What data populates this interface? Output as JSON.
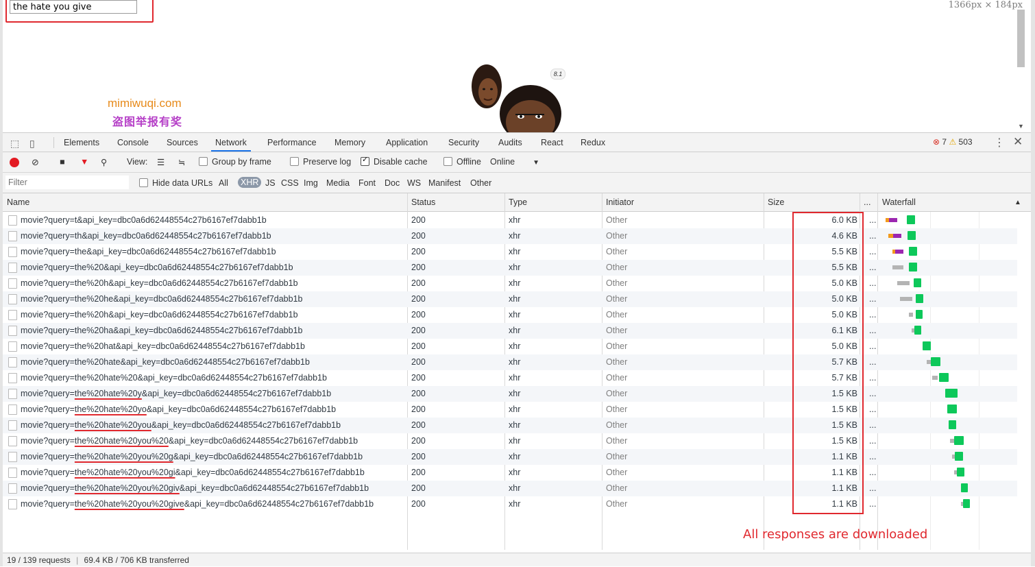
{
  "page": {
    "search_value": "the hate you give",
    "dimensions": "1366px  ×  184px",
    "watermark_line1": "mimiwuqi.com",
    "watermark_line2": "盗图举报有奖",
    "rating": "8.1"
  },
  "devtools": {
    "tabs": [
      "Elements",
      "Console",
      "Sources",
      "Network",
      "Performance",
      "Memory",
      "Application",
      "Security",
      "Audits",
      "React",
      "Redux"
    ],
    "active_tab": "Network",
    "error_count": "7",
    "warning_count": "503",
    "toolbar": {
      "view_label": "View:",
      "group_by_frame": "Group by frame",
      "preserve_log": "Preserve log",
      "disable_cache": "Disable cache",
      "offline": "Offline",
      "throttle": "Online"
    },
    "filter": {
      "placeholder": "Filter",
      "hide_data_urls": "Hide data URLs",
      "types": [
        "All",
        "XHR",
        "JS",
        "CSS",
        "Img",
        "Media",
        "Font",
        "Doc",
        "WS",
        "Manifest",
        "Other"
      ],
      "active_type": "XHR"
    },
    "columns": {
      "name": "Name",
      "status": "Status",
      "type": "Type",
      "initiator": "Initiator",
      "size": "Size",
      "more": "...",
      "waterfall": "Waterfall"
    },
    "rows": [
      {
        "prefix": "movie?query=",
        "query": "t",
        "suffix": "&api_key=dbc0a6d62448554c27b6167ef7dabb1b",
        "status": "200",
        "type": "xhr",
        "initiator": "Other",
        "size": "6.0 KB"
      },
      {
        "prefix": "movie?query=",
        "query": "th",
        "suffix": "&api_key=dbc0a6d62448554c27b6167ef7dabb1b",
        "status": "200",
        "type": "xhr",
        "initiator": "Other",
        "size": "4.6 KB"
      },
      {
        "prefix": "movie?query=",
        "query": "the",
        "suffix": "&api_key=dbc0a6d62448554c27b6167ef7dabb1b",
        "status": "200",
        "type": "xhr",
        "initiator": "Other",
        "size": "5.5 KB"
      },
      {
        "prefix": "movie?query=",
        "query": "the%20",
        "suffix": "&api_key=dbc0a6d62448554c27b6167ef7dabb1b",
        "status": "200",
        "type": "xhr",
        "initiator": "Other",
        "size": "5.5 KB"
      },
      {
        "prefix": "movie?query=",
        "query": "the%20h",
        "suffix": "&api_key=dbc0a6d62448554c27b6167ef7dabb1b",
        "status": "200",
        "type": "xhr",
        "initiator": "Other",
        "size": "5.0 KB"
      },
      {
        "prefix": "movie?query=",
        "query": "the%20he",
        "suffix": "&api_key=dbc0a6d62448554c27b6167ef7dabb1b",
        "status": "200",
        "type": "xhr",
        "initiator": "Other",
        "size": "5.0 KB"
      },
      {
        "prefix": "movie?query=",
        "query": "the%20h",
        "suffix": "&api_key=dbc0a6d62448554c27b6167ef7dabb1b",
        "status": "200",
        "type": "xhr",
        "initiator": "Other",
        "size": "5.0 KB"
      },
      {
        "prefix": "movie?query=",
        "query": "the%20ha",
        "suffix": "&api_key=dbc0a6d62448554c27b6167ef7dabb1b",
        "status": "200",
        "type": "xhr",
        "initiator": "Other",
        "size": "6.1 KB"
      },
      {
        "prefix": "movie?query=",
        "query": "the%20hat",
        "suffix": "&api_key=dbc0a6d62448554c27b6167ef7dabb1b",
        "status": "200",
        "type": "xhr",
        "initiator": "Other",
        "size": "5.0 KB"
      },
      {
        "prefix": "movie?query=",
        "query": "the%20hate",
        "suffix": "&api_key=dbc0a6d62448554c27b6167ef7dabb1b",
        "status": "200",
        "type": "xhr",
        "initiator": "Other",
        "size": "5.7 KB"
      },
      {
        "prefix": "movie?query=",
        "query": "the%20hate%20",
        "suffix": "&api_key=dbc0a6d62448554c27b6167ef7dabb1b",
        "status": "200",
        "type": "xhr",
        "initiator": "Other",
        "size": "5.7 KB"
      },
      {
        "prefix": "movie?query=",
        "query": "the%20hate%20y",
        "suffix": "&api_key=dbc0a6d62448554c27b6167ef7dabb1b",
        "status": "200",
        "type": "xhr",
        "initiator": "Other",
        "size": "1.5 KB",
        "underlined": true
      },
      {
        "prefix": "movie?query=",
        "query": "the%20hate%20yo",
        "suffix": "&api_key=dbc0a6d62448554c27b6167ef7dabb1b",
        "status": "200",
        "type": "xhr",
        "initiator": "Other",
        "size": "1.5 KB",
        "underlined": true
      },
      {
        "prefix": "movie?query=",
        "query": "the%20hate%20you",
        "suffix": "&api_key=dbc0a6d62448554c27b6167ef7dabb1b",
        "status": "200",
        "type": "xhr",
        "initiator": "Other",
        "size": "1.5 KB",
        "underlined": true
      },
      {
        "prefix": "movie?query=",
        "query": "the%20hate%20you%20",
        "suffix": "&api_key=dbc0a6d62448554c27b6167ef7dabb1b",
        "status": "200",
        "type": "xhr",
        "initiator": "Other",
        "size": "1.5 KB",
        "underlined": true
      },
      {
        "prefix": "movie?query=",
        "query": "the%20hate%20you%20g",
        "suffix": "&api_key=dbc0a6d62448554c27b6167ef7dabb1b",
        "status": "200",
        "type": "xhr",
        "initiator": "Other",
        "size": "1.1 KB",
        "underlined": true
      },
      {
        "prefix": "movie?query=",
        "query": "the%20hate%20you%20gi",
        "suffix": "&api_key=dbc0a6d62448554c27b6167ef7dabb1b",
        "status": "200",
        "type": "xhr",
        "initiator": "Other",
        "size": "1.1 KB",
        "underlined": true
      },
      {
        "prefix": "movie?query=",
        "query": "the%20hate%20you%20giv",
        "suffix": "&api_key=dbc0a6d62448554c27b6167ef7dabb1b",
        "status": "200",
        "type": "xhr",
        "initiator": "Other",
        "size": "1.1 KB",
        "underlined": true
      },
      {
        "prefix": "movie?query=",
        "query": "the%20hate%20you%20give",
        "suffix": "&api_key=dbc0a6d62448554c27b6167ef7dabb1b",
        "status": "200",
        "type": "xhr",
        "initiator": "Other",
        "size": "1.1 KB",
        "underlined": true
      }
    ],
    "annotation": "All responses are downloaded",
    "status_bar": {
      "requests": "19 / 139 requests",
      "transferred": "69.4 KB / 706 KB transferred"
    }
  },
  "colors": {
    "annotation_red": "#e0282e",
    "active_tab_blue": "#1a73e8",
    "waterfall_green": "#0dc85a",
    "waterfall_purple": "#9c27b0",
    "waterfall_orange": "#f29a1d",
    "waterfall_gray": "#b4b4b4"
  }
}
